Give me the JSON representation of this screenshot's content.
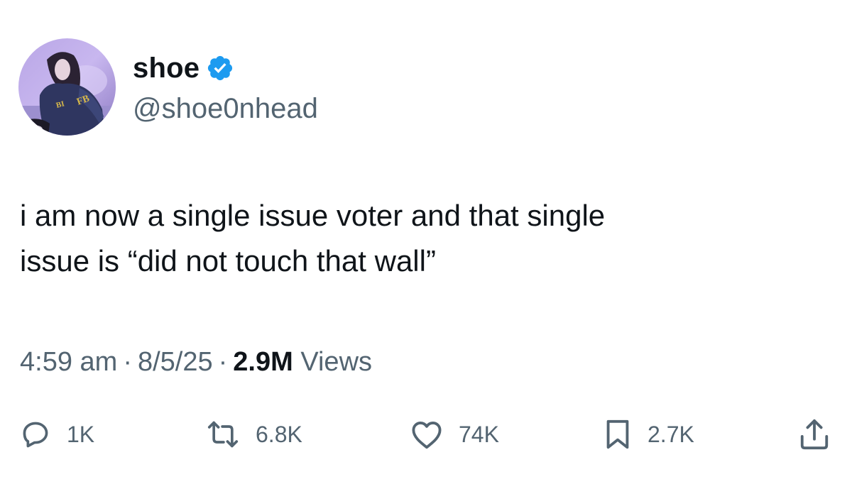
{
  "user": {
    "display_name": "shoe",
    "handle": "@shoe0nhead",
    "verified": true,
    "verified_color": "#1d9bf0"
  },
  "tweet": {
    "text": "i am now a single issue voter and that single\nissue is “did not touch that wall”"
  },
  "meta": {
    "time": "4:59 am",
    "date": "8/5/25",
    "views_count": "2.9M",
    "views_label": "Views",
    "separator": "·"
  },
  "actions": {
    "reply": {
      "icon": "reply-icon",
      "count": "1K"
    },
    "retweet": {
      "icon": "retweet-icon",
      "count": "6.8K"
    },
    "like": {
      "icon": "heart-icon",
      "count": "74K"
    },
    "bookmark": {
      "icon": "bookmark-icon",
      "count": "2.7K"
    },
    "share": {
      "icon": "share-icon"
    }
  },
  "colors": {
    "text_primary": "#0f1419",
    "text_secondary": "#536471",
    "icon": "#536471"
  }
}
